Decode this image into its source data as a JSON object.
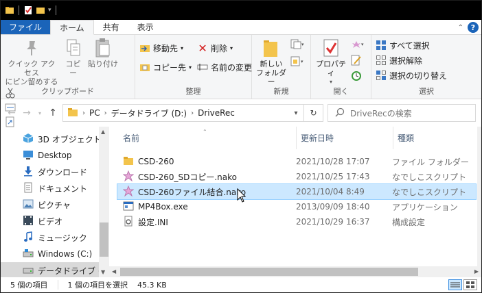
{
  "ribbon_tabs": [
    "ファイル",
    "ホーム",
    "共有",
    "表示"
  ],
  "colors": {
    "accent": "#1b64b9",
    "selection": "#cce8ff",
    "folder": "#f3c44c"
  },
  "clipboard_group": {
    "pin_label": "クイック アクセス\nにピン留めする",
    "copy_label": "コピー",
    "paste_label": "貼り付け",
    "label": "クリップボード"
  },
  "organize_group": {
    "move_to": "移動先",
    "copy_to": "コピー先",
    "delete": "削除",
    "rename": "名前の変更",
    "label": "整理"
  },
  "new_group": {
    "new_folder": "新しい\nフォルダー",
    "label": "新規"
  },
  "open_group": {
    "properties": "プロパティ",
    "label": "開く"
  },
  "select_group": {
    "select_all": "すべて選択",
    "select_none": "選択解除",
    "invert": "選択の切り替え",
    "label": "選択"
  },
  "address": {
    "crumbs": [
      "PC",
      "データドライブ (D:)",
      "DriveRec"
    ],
    "search_placeholder": "DriveRecの検索"
  },
  "nav_pane": {
    "items": [
      {
        "label": "3D オブジェクト",
        "icon": "3d-objects-icon"
      },
      {
        "label": "Desktop",
        "icon": "desktop-icon"
      },
      {
        "label": "ダウンロード",
        "icon": "download-icon"
      },
      {
        "label": "ドキュメント",
        "icon": "document-icon"
      },
      {
        "label": "ピクチャ",
        "icon": "pictures-icon"
      },
      {
        "label": "ビデオ",
        "icon": "video-icon"
      },
      {
        "label": "ミュージック",
        "icon": "music-icon"
      },
      {
        "label": "Windows (C:)",
        "icon": "drive-icon"
      },
      {
        "label": "データドライブ (D:)",
        "icon": "drive-icon"
      }
    ]
  },
  "columns": {
    "name": "名前",
    "date": "更新日時",
    "type": "種類"
  },
  "files": [
    {
      "name": "CSD-260",
      "date": "2021/10/28 17:07",
      "type": "ファイル フォルダー",
      "icon": "folder-icon"
    },
    {
      "name": "CSD-260_SDコピー.nako",
      "date": "2021/10/25 17:43",
      "type": "なでしこスクリプト",
      "icon": "nako-icon"
    },
    {
      "name": "CSD-260ファイル結合.nako",
      "date": "2021/10/04 8:49",
      "type": "なでしこスクリプト",
      "icon": "nako-icon"
    },
    {
      "name": "MP4Box.exe",
      "date": "2013/09/09 18:40",
      "type": "アプリケーション",
      "icon": "exe-icon"
    },
    {
      "name": "設定.INI",
      "date": "2021/10/29 16:37",
      "type": "構成設定",
      "icon": "ini-icon"
    }
  ],
  "status": {
    "item_count": "5 個の項目",
    "selected": "1 個の項目を選択",
    "size": "45.3 KB"
  }
}
